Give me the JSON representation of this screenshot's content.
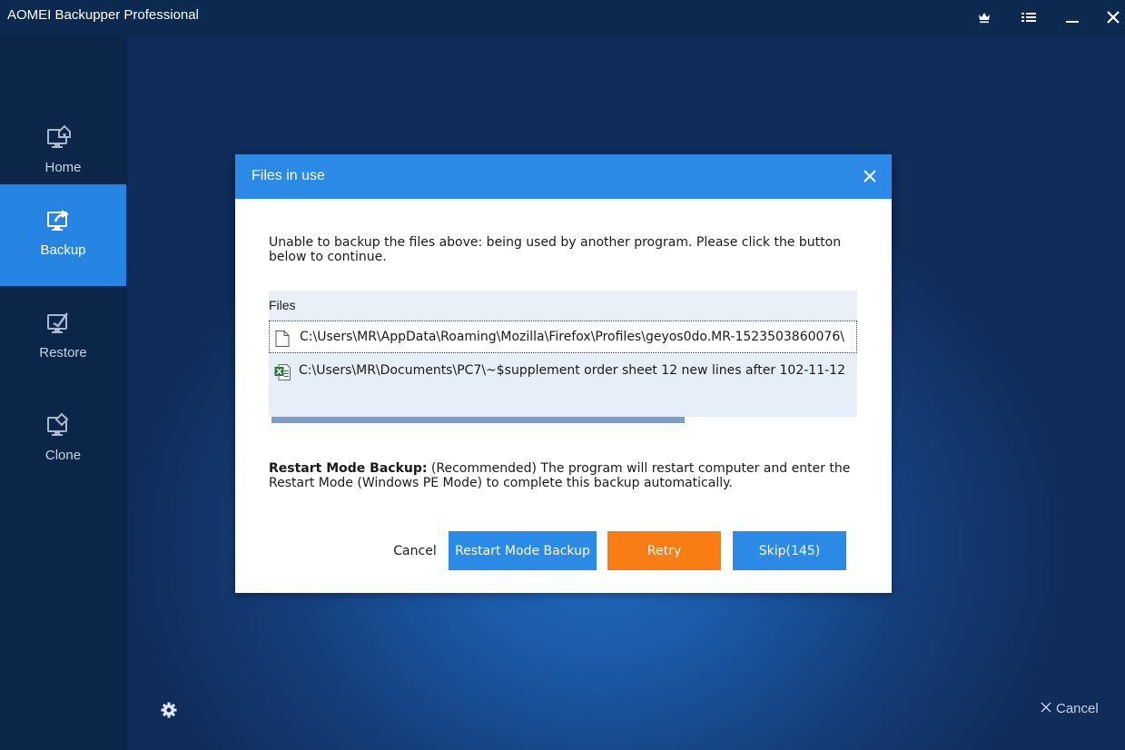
{
  "app": {
    "title": "AOMEI Backupper Professional"
  },
  "window_controls": [
    "crown-icon",
    "menu-icon",
    "minimize-icon",
    "close-icon"
  ],
  "sidebar": {
    "items": [
      {
        "label": "Home",
        "icon": "home-icon",
        "active": false
      },
      {
        "label": "Backup",
        "icon": "backup-icon",
        "active": true
      },
      {
        "label": "Restore",
        "icon": "restore-icon",
        "active": false
      },
      {
        "label": "Clone",
        "icon": "clone-icon",
        "active": false
      }
    ]
  },
  "footer": {
    "cancel_label": "Cancel"
  },
  "dialog": {
    "title": "Files in use",
    "message": "Unable to backup the files above: being used by another program. Please click the button below to continue.",
    "files_header": "Files",
    "files": [
      {
        "path": "C:\\Users\\MR\\AppData\\Roaming\\Mozilla\\Firefox\\Profiles\\geyos0do.MR-1523503860076\\",
        "icon": "file-icon"
      },
      {
        "path": "C:\\Users\\MR\\Documents\\PC7\\~$supplement order sheet 12 new lines after 102-11-12",
        "icon": "excel-file-icon"
      }
    ],
    "restart_note_bold": "Restart Mode Backup:",
    "restart_note_text": " (Recommended) The program will restart computer and enter the Restart Mode (Windows PE Mode) to complete this backup automatically.",
    "buttons": {
      "cancel": "Cancel",
      "restart": "Restart Mode Backup",
      "retry": "Retry",
      "skip": "Skip(145)"
    }
  },
  "colors": {
    "accent_blue": "#2a8ae6",
    "retry_orange": "#fa7d14",
    "sidebar_bg": "#0c2649",
    "titlebar_bg": "#0c2a4f"
  }
}
